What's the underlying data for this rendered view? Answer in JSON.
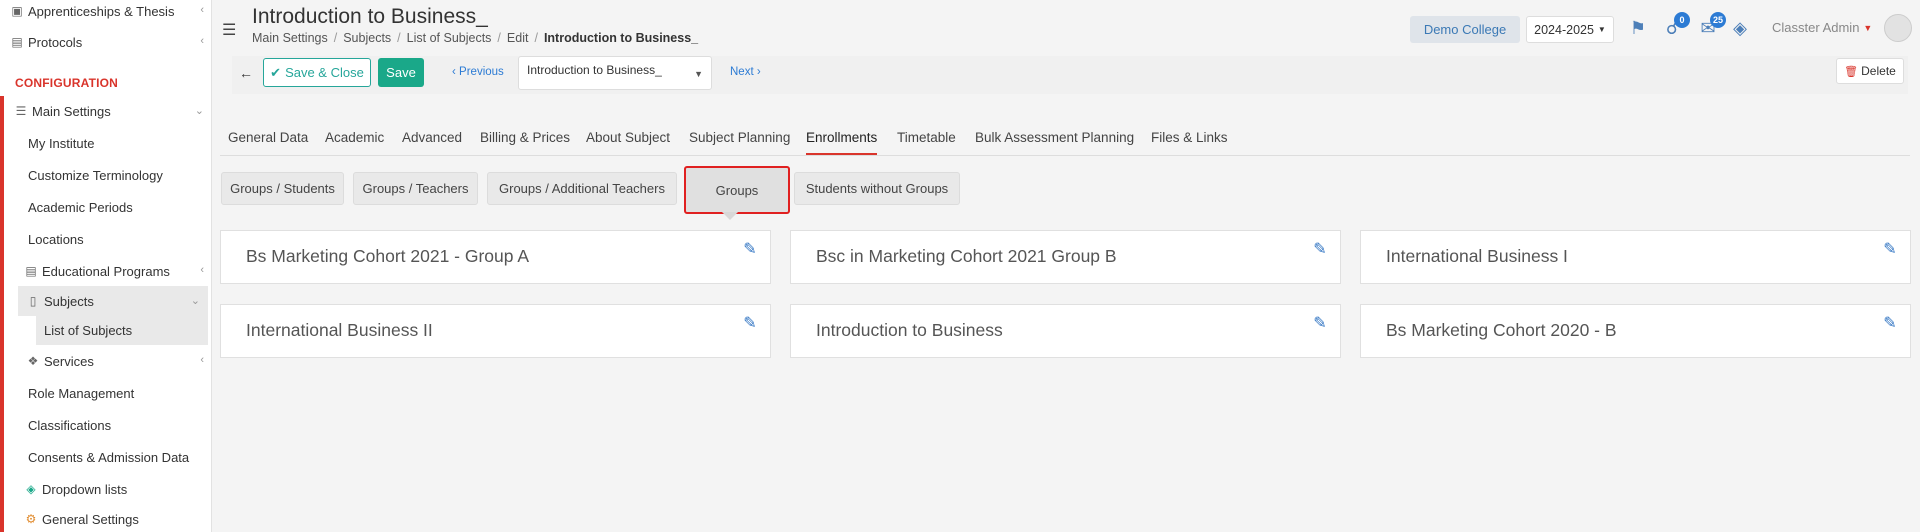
{
  "sidebar": {
    "top_items": [
      {
        "label": "Apprenticeships & Thesis",
        "icon": "cube-icon"
      },
      {
        "label": "Protocols",
        "icon": "protocol-icon"
      }
    ],
    "section_header": "CONFIGURATION",
    "main_settings": "Main Settings",
    "items": [
      {
        "label": "My Institute"
      },
      {
        "label": "Customize Terminology"
      },
      {
        "label": "Academic Periods"
      },
      {
        "label": "Locations"
      },
      {
        "label": "Educational Programs"
      },
      {
        "label": "Subjects"
      },
      {
        "label": "List of Subjects"
      },
      {
        "label": "Services"
      },
      {
        "label": "Role Management"
      },
      {
        "label": "Classifications"
      },
      {
        "label": "Consents & Admission Data"
      },
      {
        "label": "Dropdown lists"
      },
      {
        "label": "General Settings"
      }
    ]
  },
  "header": {
    "title": "Introduction to Business_",
    "breadcrumb": [
      "Main Settings",
      "Subjects",
      "List of Subjects",
      "Edit",
      "Introduction to Business_"
    ],
    "college": "Demo College",
    "year": "2024-2025",
    "notifications_count": "0",
    "messages_count": "25",
    "user": "Classter Admin"
  },
  "toolbar": {
    "save_close_label": "Save & Close",
    "save_label": "Save",
    "previous_label": "Previous",
    "subject_value": "Introduction to Business_",
    "next_label": "Next",
    "delete_label": "Delete"
  },
  "tabs": [
    "General Data",
    "Academic",
    "Advanced",
    "Billing & Prices",
    "About Subject",
    "Subject Planning",
    "Enrollments",
    "Timetable",
    "Bulk Assessment Planning",
    "Files & Links"
  ],
  "subtabs": [
    "Groups / Students",
    "Groups / Teachers",
    "Groups / Additional Teachers",
    "Groups",
    "Students without Groups"
  ],
  "groups": [
    "Bs Marketing Cohort 2021 - Group A",
    "Bsc in Marketing Cohort 2021 Group B",
    "International Business I",
    "International Business II",
    "Introduction to Business",
    "Bs Marketing Cohort 2020 - B"
  ],
  "colors": {
    "accent_red": "#d9342b",
    "save_green": "#1aa889",
    "link_blue": "#2c7bd4"
  }
}
